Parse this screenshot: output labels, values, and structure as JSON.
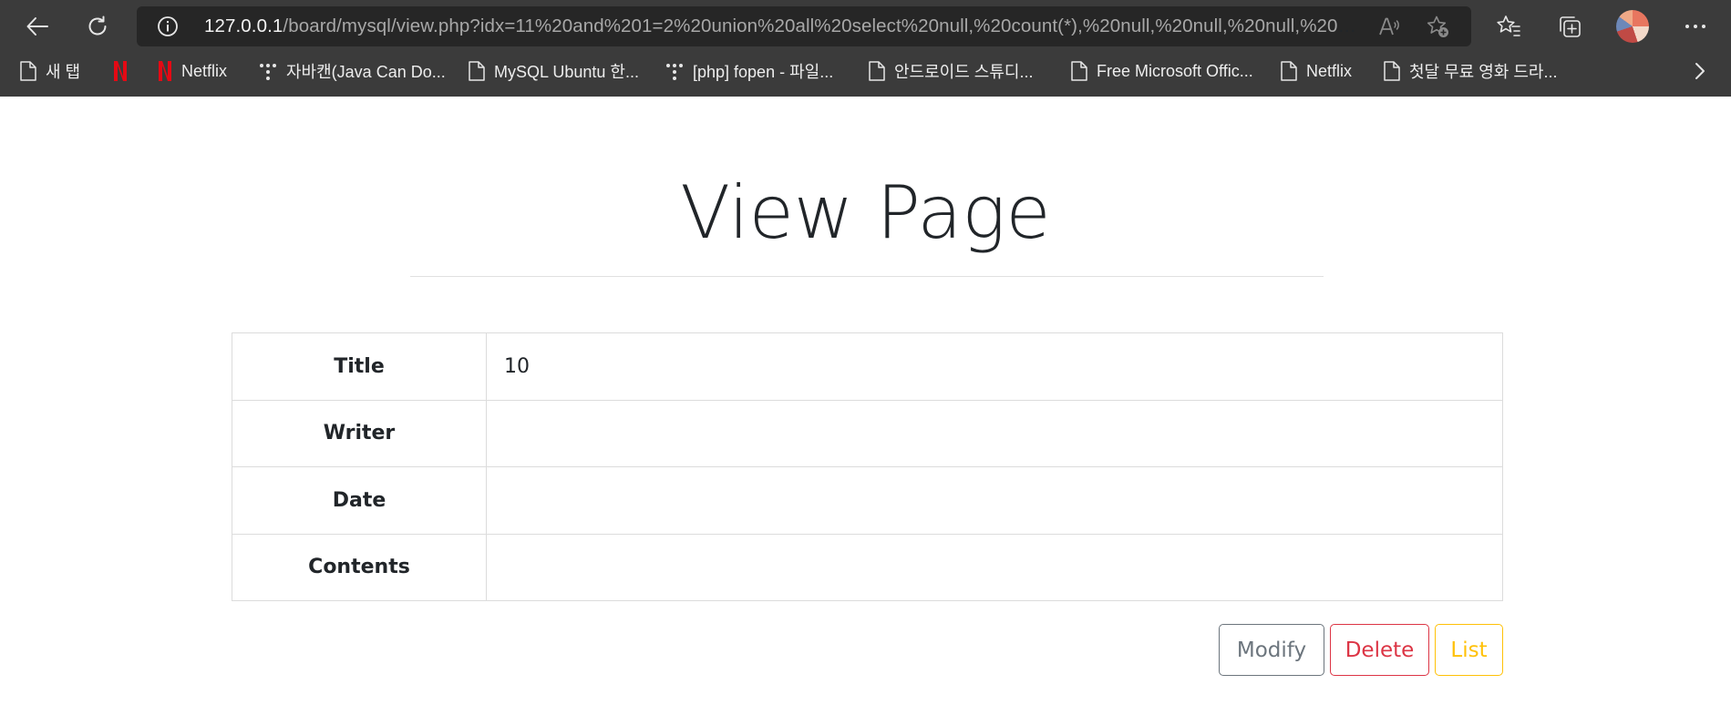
{
  "browser": {
    "url_host": "127.0.0.1",
    "url_path": "/board/mysql/view.php?idx=11%20and%201=2%20union%20all%20select%20null,%20count(*),%20null,%20null,%20null,%20n...",
    "bookmarks": [
      {
        "label": "새 탭",
        "icon": "page-icon"
      },
      {
        "label": "",
        "icon": "netflix-icon"
      },
      {
        "label": "Netflix",
        "icon": "netflix-icon"
      },
      {
        "label": "자바캔(Java Can Do...",
        "icon": "dots-icon"
      },
      {
        "label": "MySQL Ubuntu 한...",
        "icon": "page-icon"
      },
      {
        "label": "[php] fopen - 파일...",
        "icon": "dots-icon"
      },
      {
        "label": "안드로이드 스튜디...",
        "icon": "page-icon"
      },
      {
        "label": "Free Microsoft Offic...",
        "icon": "page-icon"
      },
      {
        "label": "Netflix",
        "icon": "page-icon"
      },
      {
        "label": "첫달 무료 영화 드라...",
        "icon": "page-icon"
      }
    ]
  },
  "page": {
    "title": "View Page",
    "table": {
      "title_label": "Title",
      "title_value": "10",
      "writer_label": "Writer",
      "writer_value": "",
      "date_label": "Date",
      "date_value": "",
      "contents_label": "Contents",
      "contents_value": ""
    },
    "buttons": {
      "modify": "Modify",
      "delete": "Delete",
      "list": "List"
    }
  },
  "colors": {
    "chrome_bg": "#3b3b3b",
    "addressbar_bg": "#262626",
    "modify": "#6c757d",
    "delete": "#dc3545",
    "list": "#ffc107"
  }
}
